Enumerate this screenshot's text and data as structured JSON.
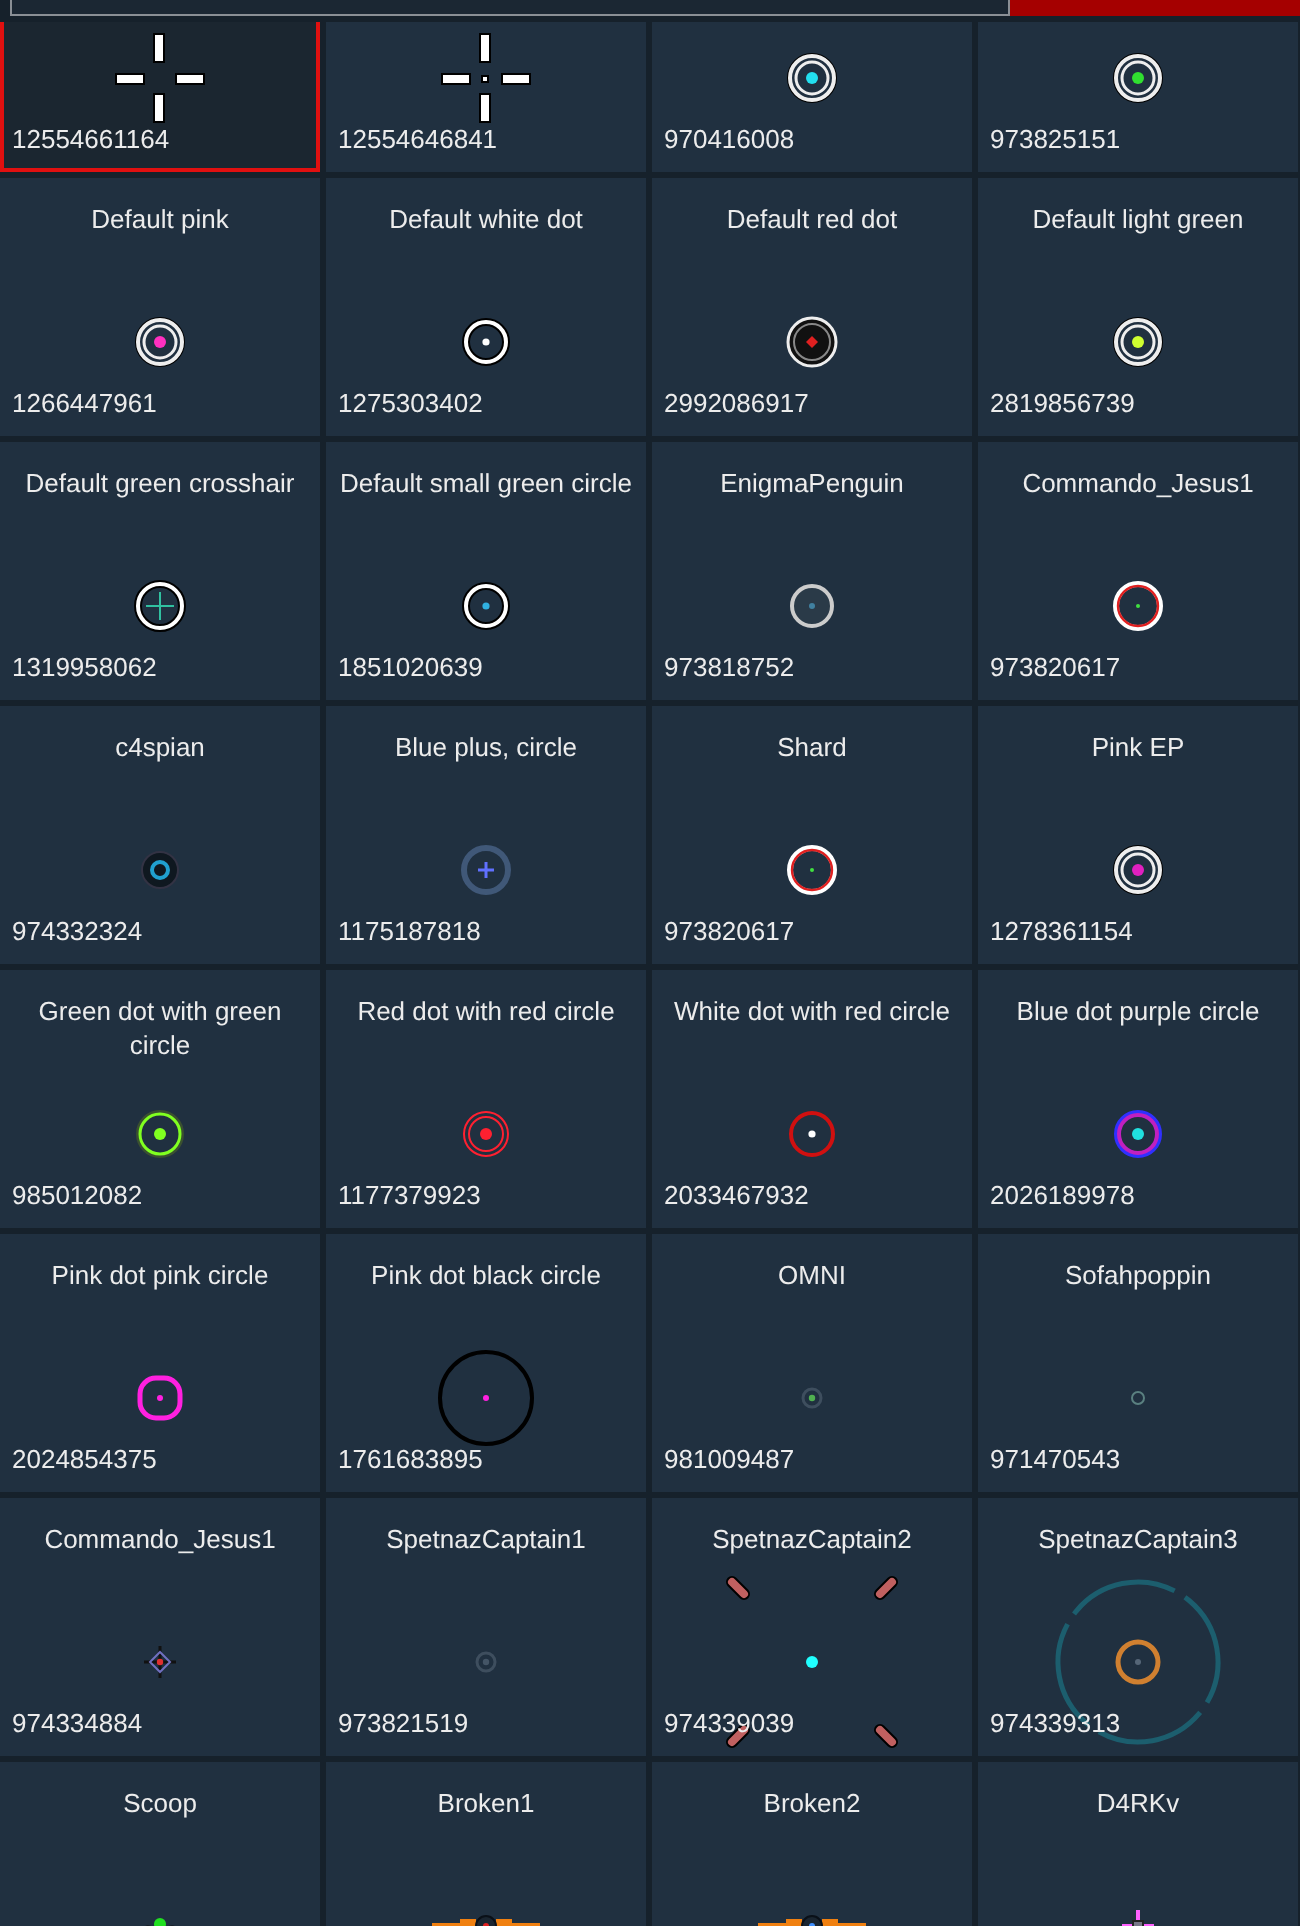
{
  "crosshairs": [
    {
      "id": "12554661164",
      "kind": "cross",
      "color": "#ffffff",
      "selected": true
    },
    {
      "id": "12554646841",
      "kind": "cross-dot",
      "color": "#ffffff",
      "selected": false
    },
    {
      "id": "970416008",
      "kind": "double-ring",
      "color": "#22e0f0",
      "selected": false
    },
    {
      "id": "973825151",
      "kind": "double-ring",
      "color": "#30e030",
      "selected": false
    },
    {
      "name": "Default pink",
      "id": "1266447961",
      "kind": "double-ring",
      "color": "#ff30c0",
      "selected": false
    },
    {
      "name": "Default white dot",
      "id": "1275303402",
      "kind": "white-ring",
      "color": "#ffffff",
      "selected": false
    },
    {
      "name": "Default red dot",
      "id": "2992086917",
      "kind": "black-ring",
      "color": "#e02020",
      "selected": false
    },
    {
      "name": "Default light green",
      "id": "2819856739",
      "kind": "double-ring",
      "color": "#d0ff30",
      "selected": false
    },
    {
      "name": "Default green crosshair",
      "id": "1319958062",
      "kind": "ring-cross",
      "color": "#30c0a0",
      "selected": false
    },
    {
      "name": "Default small green circle",
      "id": "1851020639",
      "kind": "white-ring",
      "color": "#30b0e0",
      "selected": false
    },
    {
      "name": "EnigmaPenguin",
      "id": "973818752",
      "kind": "grey-ring",
      "color": "#4080a0",
      "selected": false
    },
    {
      "name": "Commando_Jesus1",
      "id": "973820617",
      "kind": "red-white-ring",
      "color": "#40e040",
      "selected": false
    },
    {
      "name": "c4spian",
      "id": "974332324",
      "kind": "dark-ring",
      "color": "#20a0d0",
      "selected": false
    },
    {
      "name": "Blue plus, circle",
      "id": "1175187818",
      "kind": "blue-ring",
      "color": "#6070ff",
      "selected": false
    },
    {
      "name": "Shard",
      "id": "973820617",
      "kind": "red-white-ring",
      "color": "#40e040",
      "selected": false
    },
    {
      "name": "Pink EP",
      "id": "1278361154",
      "kind": "double-ring",
      "color": "#e020c0",
      "selected": false
    },
    {
      "name": "Green dot with green circle",
      "id": "985012082",
      "kind": "color-ring",
      "color": "#80ff20",
      "selected": false
    },
    {
      "name": "Red dot with red circle",
      "id": "1177379923",
      "kind": "double-color-ring",
      "color": "#ff2030",
      "selected": false
    },
    {
      "name": "White dot with red circle",
      "id": "2033467932",
      "kind": "red-ring",
      "color": "#ffffff",
      "selected": false
    },
    {
      "name": "Blue dot purple circle",
      "id": "2026189978",
      "kind": "purple-ring",
      "color": "#20e0e0",
      "selected": false
    },
    {
      "name": "Pink dot pink circle",
      "id": "2024854375",
      "kind": "pink-square",
      "color": "#ff20e0",
      "selected": false
    },
    {
      "name": "Pink dot black circle",
      "id": "1761683895",
      "kind": "big-black-ring",
      "color": "#ff20e0",
      "selected": false
    },
    {
      "name": "OMNI",
      "id": "981009487",
      "kind": "faint",
      "color": "#50b050",
      "selected": false
    },
    {
      "name": "Sofahpoppin",
      "id": "971470543",
      "kind": "faint-small",
      "color": "#5a8080",
      "selected": false
    },
    {
      "name": "Commando_Jesus1",
      "id": "974334884",
      "kind": "tiny-cross",
      "color": "#e03030",
      "selected": false
    },
    {
      "name": "SpetnazCaptain1",
      "id": "973821519",
      "kind": "faint",
      "color": "#445566",
      "selected": false
    },
    {
      "name": "SpetnazCaptain2",
      "id": "974339039",
      "kind": "ticks",
      "color": "#20ffff",
      "selected": false
    },
    {
      "name": "SpetnazCaptain3",
      "id": "974339313",
      "kind": "teal-ring",
      "color": "#d08030",
      "selected": false
    },
    {
      "name": "Scoop",
      "kind": "scoop",
      "color": "#20e020",
      "selected": false
    },
    {
      "name": "Broken1",
      "kind": "bar",
      "color": "#e02020",
      "selected": false
    },
    {
      "name": "Broken2",
      "kind": "bar",
      "color": "#4090ff",
      "selected": false
    },
    {
      "name": "D4RKv",
      "kind": "pink-cross",
      "color": "#ff60ff",
      "selected": false
    }
  ]
}
